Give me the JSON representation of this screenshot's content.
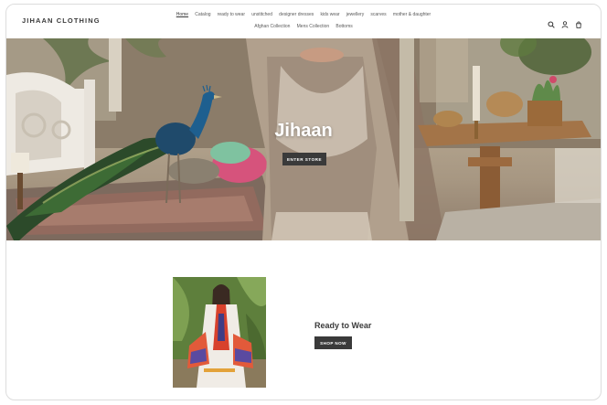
{
  "header": {
    "logo": "JIHAAN CLOTHING",
    "nav_row1": [
      "Home",
      "Catalog",
      "ready to wear",
      "unstitched",
      "designer dresses",
      "kids wear",
      "jewellery",
      "scarves",
      "mother & daughter"
    ],
    "nav_row2": [
      "Afghan Collection",
      "Mens Collection",
      "Bottoms"
    ],
    "active_nav": "Home",
    "icons": [
      "search-icon",
      "account-icon",
      "cart-icon"
    ]
  },
  "hero": {
    "title": "Jihaan",
    "button_label": "ENTER STORE"
  },
  "feature": {
    "title": "Ready to Wear",
    "button_label": "SHOP NOW"
  },
  "colors": {
    "button_bg": "#3a3a3a",
    "text": "#3a3a3a",
    "background": "#ffffff"
  }
}
